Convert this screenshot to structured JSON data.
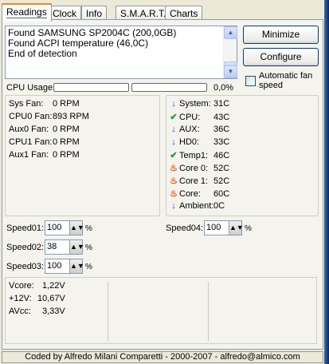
{
  "tabs": [
    "Readings",
    "Clock",
    "Info",
    "S.M.A.R.T.",
    "Charts"
  ],
  "log": [
    "Found SAMSUNG SP2004C (200,0GB)",
    "Found ACPI temperature (46,0C)",
    "End of detection"
  ],
  "buttons": {
    "minimize": "Minimize",
    "configure": "Configure"
  },
  "auto_fan": {
    "label_line1": "Automatic fan",
    "label_line2": "speed",
    "checked": false
  },
  "cpu_usage": {
    "label": "CPU Usage",
    "value": "0,0%",
    "level": 0
  },
  "fans": [
    {
      "name": "Sys Fan:",
      "value": "0 RPM"
    },
    {
      "name": "CPU0 Fan:",
      "value": "893 RPM"
    },
    {
      "name": "Aux0 Fan:",
      "value": "0 RPM"
    },
    {
      "name": "CPU1 Fan:",
      "value": "0 RPM"
    },
    {
      "name": "Aux1 Fan:",
      "value": "0 RPM"
    }
  ],
  "temps": [
    {
      "icon": "arrow-down-icon",
      "name": "System:",
      "value": "31C"
    },
    {
      "icon": "checkmark-icon",
      "name": "CPU:",
      "value": "43C"
    },
    {
      "icon": "arrow-down-icon",
      "name": "AUX:",
      "value": "36C"
    },
    {
      "icon": "arrow-down-icon",
      "name": "HD0:",
      "value": "33C"
    },
    {
      "icon": "checkmark-icon",
      "name": "Temp1:",
      "value": "46C"
    },
    {
      "icon": "flame-icon",
      "name": "Core 0:",
      "value": "52C"
    },
    {
      "icon": "flame-icon",
      "name": "Core 1:",
      "value": "52C"
    },
    {
      "icon": "flame-icon",
      "name": "Core:",
      "value": "60C"
    },
    {
      "icon": "arrow-down-icon",
      "name": "Ambient:",
      "value": "0C"
    }
  ],
  "speeds": [
    {
      "label": "Speed01:",
      "value": "100",
      "unit": "%"
    },
    {
      "label": "Speed02:",
      "value": "38",
      "unit": "%"
    },
    {
      "label": "Speed03:",
      "value": "100",
      "unit": "%"
    },
    {
      "label": "Speed04:",
      "value": "100",
      "unit": "%"
    }
  ],
  "voltages": [
    {
      "name": "Vcore:",
      "value": "1,22V"
    },
    {
      "name": "+12V:",
      "value": "10,67V"
    },
    {
      "name": "AVcc:",
      "value": "3,33V"
    }
  ],
  "footer": "Coded by Alfredo Milani Comparetti - 2000-2007 - alfredo@almico.com"
}
